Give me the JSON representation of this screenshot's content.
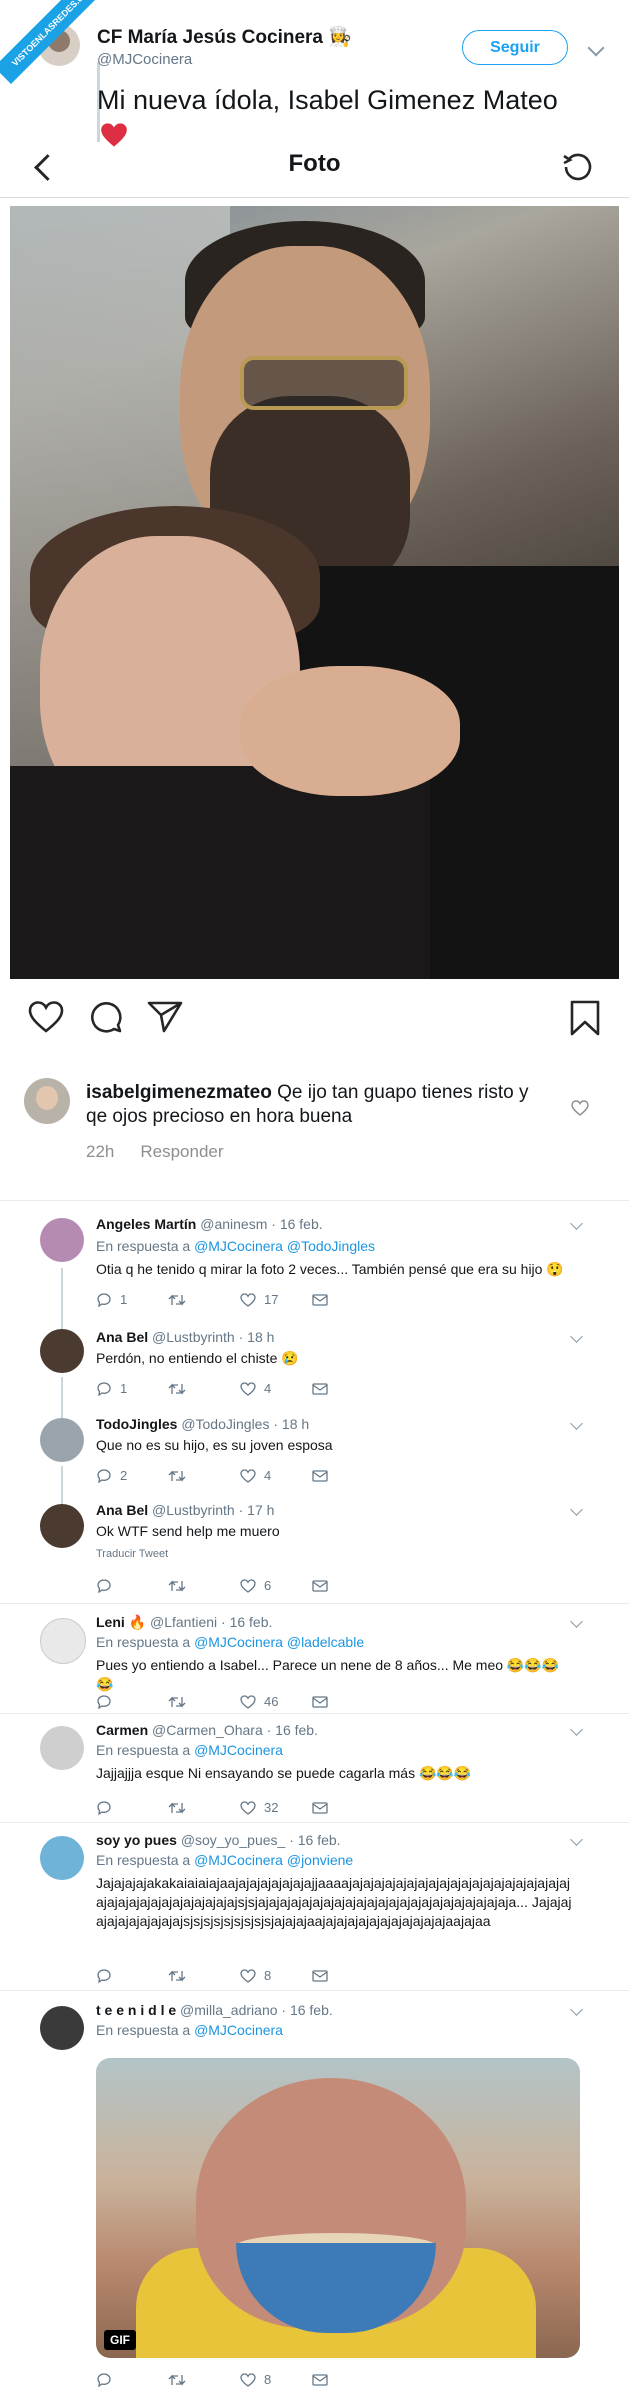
{
  "watermark": "VISTOENLASREDES.com",
  "tweet": {
    "name": "CF María Jesús Cocinera 👩‍🍳",
    "handle": "@MJCocinera",
    "follow_label": "Seguir",
    "text": "Mi nueva ídola, Isabel Gimenez Mateo"
  },
  "instagram": {
    "title": "Foto",
    "comment_user": "isabelgimenezmateo",
    "comment_text": "Qe ijo tan guapo tienes risto y qe ojos precioso en hora buena",
    "comment_time": "22h",
    "reply_label": "Responder"
  },
  "replies": [
    {
      "name": "Angeles Martín",
      "meta": "@aninesm · 16 feb.",
      "resp_prefix": "En respuesta a",
      "resp": "@MJCocinera @TodoJingles",
      "text": "Otia q he tenido q mirar la foto 2 veces... También pensé que era su hijo 😲",
      "replies": "1",
      "rts": "",
      "likes": "17"
    },
    {
      "name": "Ana Bel",
      "meta": "@Lustbyrinth · 18 h",
      "text": "Perdón, no entiendo el chiste 😢",
      "replies": "1",
      "rts": "",
      "likes": "4"
    },
    {
      "name": "TodoJingles",
      "meta": "@TodoJingles · 18 h",
      "text": "Que no es su hijo, es su joven esposa",
      "replies": "2",
      "rts": "",
      "likes": "4"
    },
    {
      "name": "Ana Bel",
      "meta": "@Lustbyrinth · 17 h",
      "text": "Ok WTF send help me muero",
      "translate": "Traducir Tweet",
      "replies": "",
      "rts": "",
      "likes": "6"
    },
    {
      "name": "Leni 🔥",
      "meta": "@Lfantieni · 16 feb.",
      "resp_prefix": "En respuesta a",
      "resp": "@MJCocinera @ladelcable",
      "text": "Pues yo entiendo a Isabel... Parece un nene de 8 años... Me meo 😂😂😂😂",
      "replies": "",
      "rts": "",
      "likes": "46"
    },
    {
      "name": "Carmen",
      "meta": "@Carmen_Ohara · 16 feb.",
      "resp_prefix": "En respuesta a",
      "resp": "@MJCocinera",
      "text": "Jajjajjja esque  Ni ensayando se puede cagarla más 😂😂😂",
      "replies": "",
      "rts": "",
      "likes": "32"
    },
    {
      "name": "soy yo pues",
      "meta": "@soy_yo_pues_ · 16 feb.",
      "resp_prefix": "En respuesta a",
      "resp": "@MJCocinera @jonviene",
      "text": "Jajajajajakakaiaiaiajaajajajajajajajajjaaaajajajajajajajajajajajajajajajajajajajajajajajajajajajajajajajajajajsjsjajajajajajajajajajajajajajajajajajajajajajajaja... Jajajajajajajajajajajajsjsjsjsjsjsjsjsjsjajajajaajajajajajajajajajajajajaajajaa",
      "replies": "",
      "rts": "",
      "likes": "8"
    },
    {
      "name": "t e e n i d l e",
      "meta": "@milla_adriano · 16 feb.",
      "resp_prefix": "En respuesta a",
      "resp": "@MJCocinera",
      "gif_label": "GIF",
      "replies": "",
      "rts": "",
      "likes": "8"
    }
  ],
  "colors": {
    "accent": "#1da1f2",
    "link": "#1b95e0",
    "heart": "#e0245e"
  }
}
